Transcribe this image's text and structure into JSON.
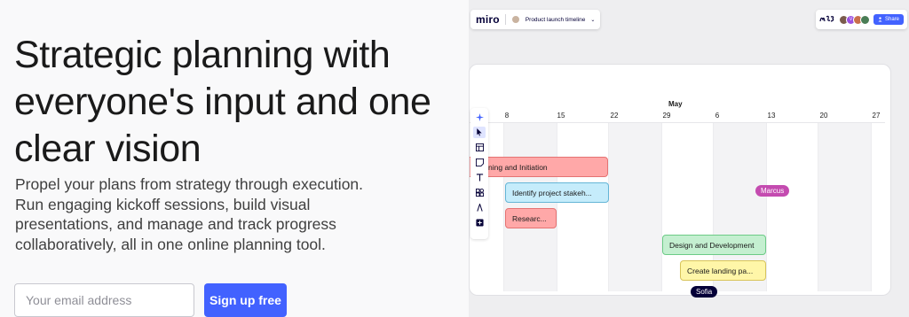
{
  "hero": {
    "headline": "Strategic planning with everyone's input and one clear vision",
    "subtext": "Propel your plans from strategy through execution. Run engaging kickoff sessions, build visual presentations, and manage and track progress collaboratively, all in one online planning tool.",
    "email_placeholder": "Your email address",
    "signup_label": "Sign up free",
    "accent_color": "#4262ff"
  },
  "app": {
    "logo": "miro",
    "board_name": "Product launch timeline",
    "reaction_label": "ᵖᵓᵓ",
    "avatar_initial": "V",
    "share_label": "Share",
    "share_icon": "person-plus-icon",
    "timeline": {
      "month": "May",
      "days": [
        "8",
        "15",
        "22",
        "29",
        "6",
        "13",
        "20",
        "27"
      ]
    },
    "bars": [
      {
        "label": "Planning and Initiation",
        "color": "red"
      },
      {
        "label": "Identify project stakeh...",
        "color": "blue"
      },
      {
        "label": "Researc...",
        "color": "red"
      },
      {
        "label": "Design and Development",
        "color": "green"
      },
      {
        "label": "Create landing pa...",
        "color": "yellow"
      }
    ],
    "tools": [
      "sparkle-icon",
      "cursor-icon",
      "template-icon",
      "sticky-note-icon",
      "text-icon",
      "shapes-icon",
      "pen-icon",
      "plus-icon"
    ],
    "collaborators": [
      {
        "name": "Marcus",
        "color": "#c44bb0"
      },
      {
        "name": "Sofia",
        "color": "#050038"
      }
    ]
  }
}
